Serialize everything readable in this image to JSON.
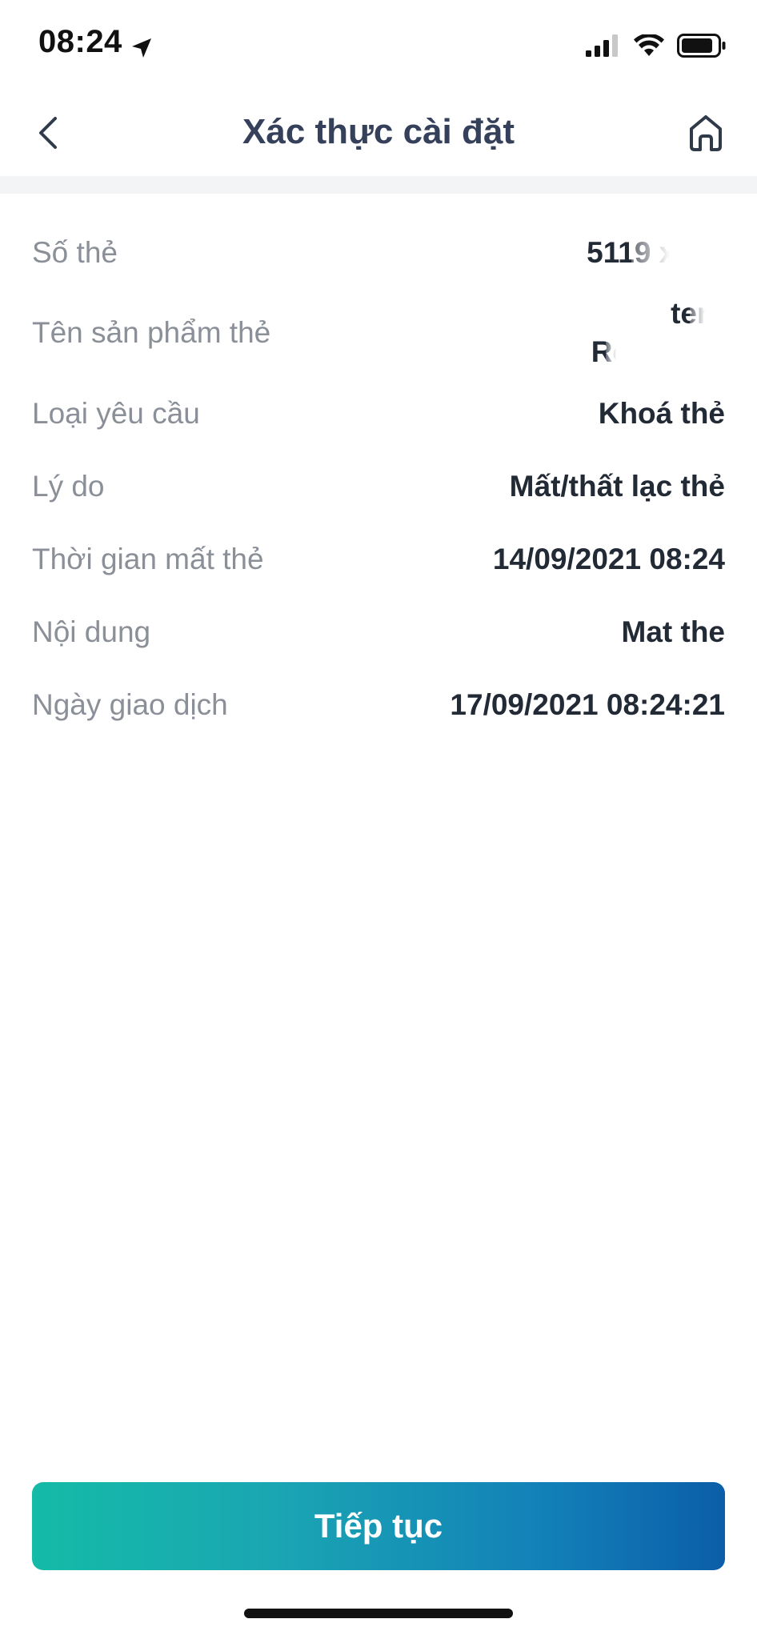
{
  "status_bar": {
    "time": "08:24",
    "icons": [
      "location-arrow-icon",
      "cellular-signal-icon",
      "wifi-icon",
      "battery-icon"
    ]
  },
  "header": {
    "title": "Xác thực cài đặt",
    "back_icon": "chevron-left-icon",
    "home_icon": "home-icon"
  },
  "details": [
    {
      "label": "Số thẻ",
      "value": "5119 xxxx"
    },
    {
      "label": "Tên sản phẩm thẻ",
      "value_lines": [
        "terc",
        "Re"
      ]
    },
    {
      "label": "Loại yêu cầu",
      "value": "Khoá thẻ"
    },
    {
      "label": "Lý do",
      "value": "Mất/thất lạc thẻ"
    },
    {
      "label": "Thời gian mất thẻ",
      "value": "14/09/2021 08:24"
    },
    {
      "label": "Nội dung",
      "value": "Mat the"
    },
    {
      "label": "Ngày giao dịch",
      "value": "17/09/2021 08:24:21"
    }
  ],
  "continue_button": {
    "label": "Tiếp tục"
  },
  "colors": {
    "button_gradient_start": "#14bba7",
    "button_gradient_end": "#0b5ea8",
    "label": "#8a8f98",
    "value": "#222a36",
    "title": "#35405a"
  }
}
